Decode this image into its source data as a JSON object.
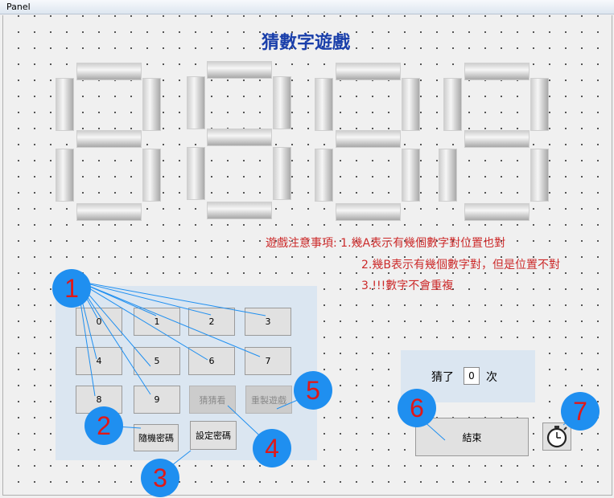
{
  "window": {
    "title": "Panel"
  },
  "game_title": "猜數字遊戲",
  "rules": {
    "line1": "遊戲注意事項: 1.幾A表示有幾個數字對位置也對",
    "line2": "2.幾B表示有幾個數字對，但是位置不對",
    "line3": "3.!!!數字不會重複"
  },
  "keypad": {
    "keys": [
      "0",
      "1",
      "2",
      "3",
      "4",
      "5",
      "6",
      "7",
      "8",
      "9"
    ],
    "guess_label": "猜猜看",
    "reset_label": "重製遊戲",
    "random_label": "隨機密碼",
    "set_label": "設定密碼"
  },
  "counter": {
    "prefix": "猜了",
    "value": "0",
    "suffix": "次"
  },
  "end_label": "結束",
  "timer_icon": "stopwatch-icon",
  "callouts": [
    "1",
    "2",
    "3",
    "4",
    "5",
    "6",
    "7"
  ],
  "colors": {
    "callout_bg": "#1f8ff0",
    "callout_text": "#e01818",
    "rules_text": "#cc2a2a",
    "title_text": "#1a3faa"
  }
}
